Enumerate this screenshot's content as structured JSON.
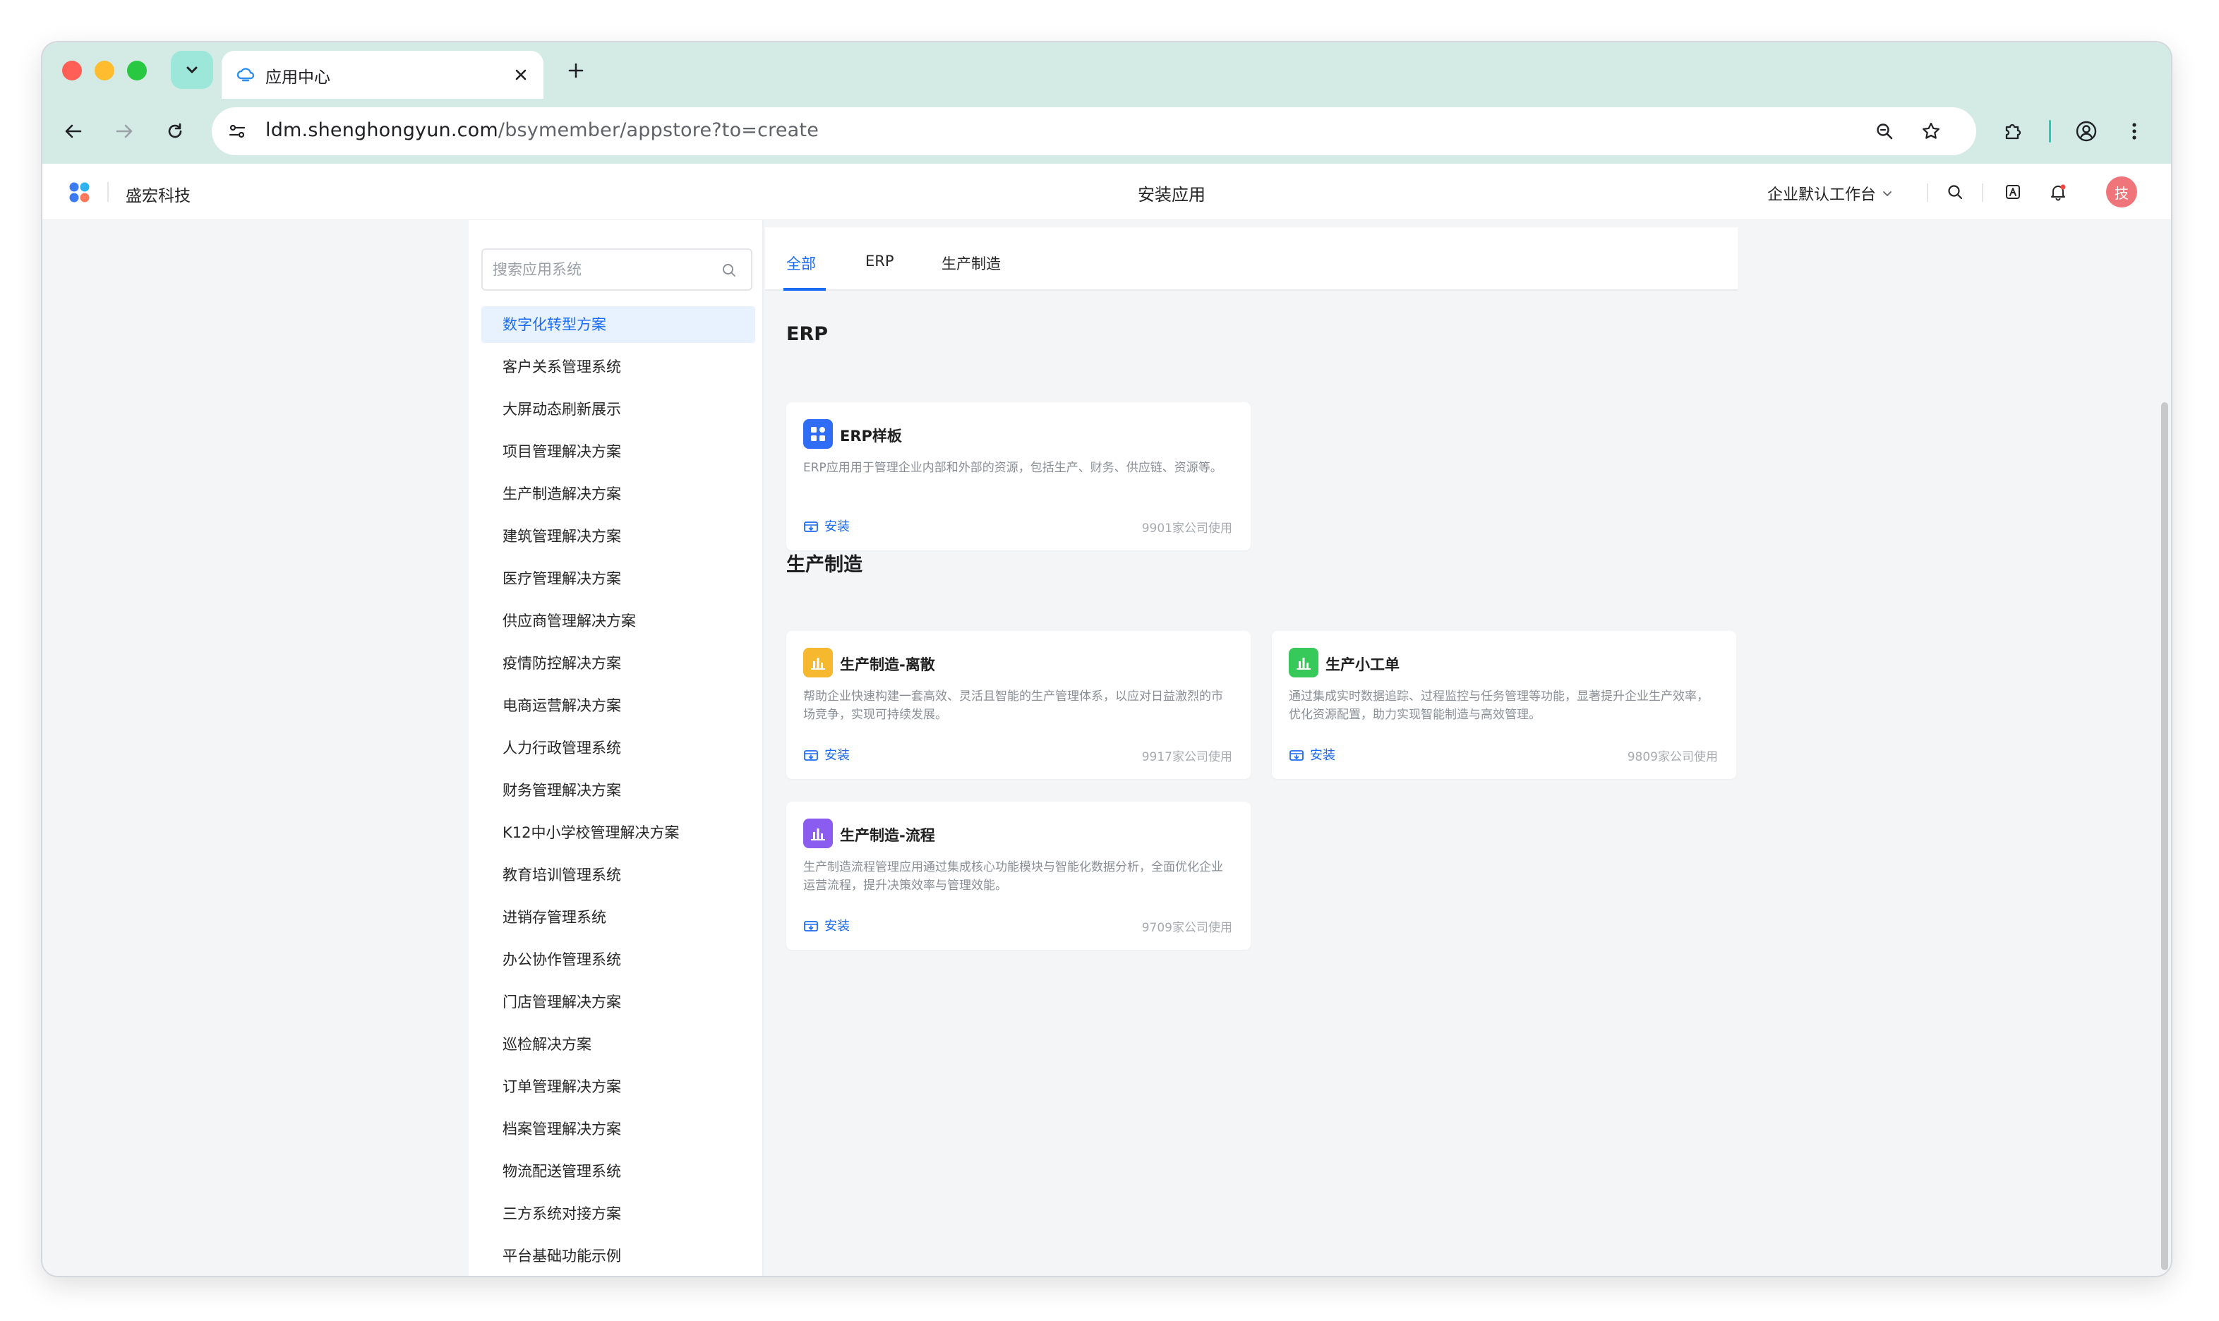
{
  "browser": {
    "tab_title": "应用中心",
    "url_host": "ldm.shenghongyun.com",
    "url_path": "/bsymember/appstore?to=create"
  },
  "app": {
    "brand": "盛宏科技",
    "page_title": "安装应用",
    "workspace": "企业默认工作台",
    "avatar_text": "技",
    "avatar_color": "#f0757b",
    "accent": "#1a6bf2"
  },
  "sidebar": {
    "search_placeholder": "搜索应用系统",
    "items": [
      {
        "label": "数字化转型方案",
        "active": true
      },
      {
        "label": "客户关系管理系统"
      },
      {
        "label": "大屏动态刷新展示"
      },
      {
        "label": "项目管理解决方案"
      },
      {
        "label": "生产制造解决方案"
      },
      {
        "label": "建筑管理解决方案"
      },
      {
        "label": "医疗管理解决方案"
      },
      {
        "label": "供应商管理解决方案"
      },
      {
        "label": "疫情防控解决方案"
      },
      {
        "label": "电商运营解决方案"
      },
      {
        "label": "人力行政管理系统"
      },
      {
        "label": "财务管理解决方案"
      },
      {
        "label": "K12中小学校管理解决方案"
      },
      {
        "label": "教育培训管理系统"
      },
      {
        "label": "进销存管理系统"
      },
      {
        "label": "办公协作管理系统"
      },
      {
        "label": "门店管理解决方案"
      },
      {
        "label": "巡检解决方案"
      },
      {
        "label": "订单管理解决方案"
      },
      {
        "label": "档案管理解决方案"
      },
      {
        "label": "物流配送管理系统"
      },
      {
        "label": "三方系统对接方案"
      },
      {
        "label": "平台基础功能示例"
      }
    ]
  },
  "tabs": [
    {
      "label": "全部",
      "active": true
    },
    {
      "label": "ERP"
    },
    {
      "label": "生产制造"
    }
  ],
  "sections": [
    {
      "title": "ERP",
      "cards": [
        {
          "name": "ERP样板",
          "icon": "grid-apps-icon",
          "icon_color": "#2f6df6",
          "desc": "ERP应用用于管理企业内部和外部的资源，包括生产、财务、供应链、资源等。",
          "install": "安装",
          "uses": "9901家公司使用"
        }
      ]
    },
    {
      "title": "生产制造",
      "cards": [
        {
          "name": "生产制造-离散",
          "icon": "bar-chart-icon",
          "icon_color": "#f5b82e",
          "desc": "帮助企业快速构建一套高效、灵活且智能的生产管理体系，以应对日益激烈的市场竞争，实现可持续发展。",
          "install": "安装",
          "uses": "9917家公司使用"
        },
        {
          "name": "生产小工单",
          "icon": "bar-chart-icon",
          "icon_color": "#37c95a",
          "desc": "通过集成实时数据追踪、过程监控与任务管理等功能，显著提升企业生产效率，优化资源配置，助力实现智能制造与高效管理。",
          "install": "安装",
          "uses": "9809家公司使用"
        },
        {
          "name": "生产制造-流程",
          "icon": "bar-chart-icon",
          "icon_color": "#8a5cf0",
          "desc": "生产制造流程管理应用通过集成核心功能模块与智能化数据分析，全面优化企业运营流程，提升决策效率与管理效能。",
          "install": "安装",
          "uses": "9709家公司使用"
        }
      ]
    }
  ]
}
